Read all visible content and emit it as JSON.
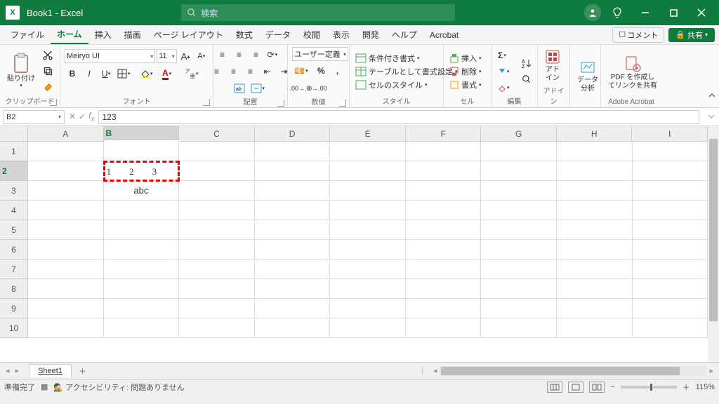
{
  "title": "Book1  -  Excel",
  "search_ph": "検索",
  "menus": [
    "ファイル",
    "ホーム",
    "挿入",
    "描画",
    "ページ レイアウト",
    "数式",
    "データ",
    "校閲",
    "表示",
    "開発",
    "ヘルプ",
    "Acrobat"
  ],
  "active_menu": 1,
  "comment_btn": "コメント",
  "share_btn": "共有",
  "ribbon": {
    "clipboard": {
      "paste": "貼り付け",
      "label": "クリップボード"
    },
    "font": {
      "name": "Meiryo UI",
      "size": "11",
      "label": "フォント"
    },
    "align": {
      "label": "配置"
    },
    "number": {
      "format": "ユーザー定義",
      "label": "数値"
    },
    "styles": {
      "cond": "条件付き書式 ",
      "table": "テーブルとして書式設定 ",
      "cell": "セルのスタイル ",
      "label": "スタイル"
    },
    "cells": {
      "insert": "挿入",
      "delete": "削除",
      "format": "書式",
      "label": "セル"
    },
    "edit": {
      "label": "編集"
    },
    "addin": {
      "btn": "アド\nイン",
      "label": "アドイン"
    },
    "data": {
      "btn": "データ\n分析"
    },
    "adobe": {
      "btn": "PDF を作成し\nてリンクを共有",
      "label": "Adobe Acrobat"
    }
  },
  "namebox": "B2",
  "formula": "123",
  "cols": [
    "A",
    "B",
    "C",
    "D",
    "E",
    "F",
    "G",
    "H",
    "I"
  ],
  "rows": [
    "1",
    "2",
    "3",
    "4",
    "5",
    "6",
    "7",
    "8",
    "9",
    "10"
  ],
  "sel": {
    "row": 1,
    "col": 1
  },
  "celldata": {
    "1": {
      "1": "1　　2　　3"
    },
    "2": {
      "1": "abc"
    }
  },
  "cellalign": {
    "2": {
      "1": "center"
    }
  },
  "sheet": "Sheet1",
  "status": {
    "ready": "準備完了",
    "access": "アクセシビリティ: 問題ありません",
    "zoom": "115%"
  }
}
